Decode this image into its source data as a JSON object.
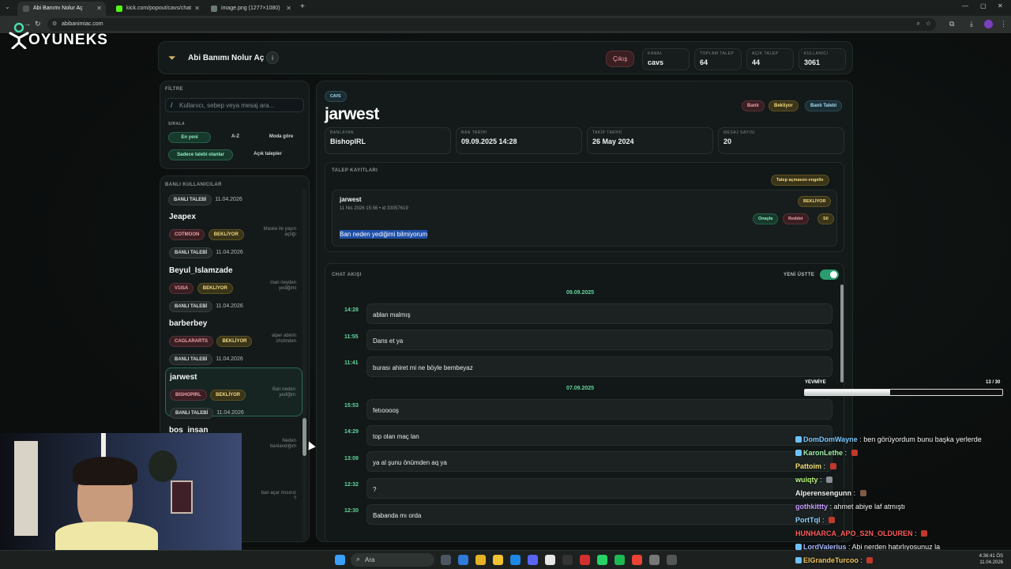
{
  "browser": {
    "tabs": [
      {
        "label": "Abi Banımı Nolur Aç"
      },
      {
        "label": "kick.com/popout/cavs/chat"
      },
      {
        "label": "image.png (1277×1080)"
      }
    ],
    "url": "abibanimiac.com"
  },
  "overlay": {
    "logo_text": "OYUNEKS"
  },
  "header": {
    "title": "Abi Banımı Nolur Aç",
    "info": "i",
    "logout": "Çıkış",
    "stats": [
      {
        "key": "KANAL",
        "value": "cavs"
      },
      {
        "key": "TOPLAM TALEP",
        "value": "64"
      },
      {
        "key": "AÇIK TALEP",
        "value": "44"
      },
      {
        "key": "KULLANICI",
        "value": "3061"
      }
    ]
  },
  "filter": {
    "label": "FİLTRE",
    "placeholder": "Kullanıcı, sebep veya mesaj ara...",
    "sort_label": "SIRALA",
    "sort": [
      "En yeni",
      "A-Z",
      "Moda göre"
    ],
    "only_requests": "Sadece talebi olanlar",
    "open_requests": "Açık talepler"
  },
  "banned": {
    "label": "BANLI KULLANICILAR",
    "first_row": {
      "tag": "BANLI TALEBİ",
      "date": "11.04.2026"
    },
    "users": [
      {
        "name": "Jeapex",
        "by": "COTMOON",
        "status": "BEKLİYOR",
        "tag": "BANLI TALEBİ",
        "date": "11.04.2026",
        "note": "Maske ile yayın açtığı"
      },
      {
        "name": "Beyul_Islamzade",
        "by": "V1ISA",
        "status": "BEKLİYOR",
        "tag": "BANLI TALEBİ",
        "date": "11.04.2026",
        "note": "inan neyden yediğimi"
      },
      {
        "name": "barberbey",
        "by": "CAGLARARTS",
        "status": "BEKLİYOR",
        "tag": "BANLI TALEBİ",
        "date": "11.04.2026",
        "note": "alper abinin chstinden"
      },
      {
        "name": "jarwest",
        "by": "BISHOPIRL",
        "status": "BEKLİYOR",
        "tag": "BANLI TALEBİ",
        "date": "11.04.2026",
        "note": "Ban neden yediğim"
      },
      {
        "name": "bos_insan",
        "note": "Neden banlandığım"
      }
    ],
    "last_note": "ban açar mısınız ?"
  },
  "detail": {
    "channel_tag": "CAVS",
    "username": "jarwest",
    "actions": [
      "Banlı",
      "Bekliyor",
      "Banlı Talebi"
    ],
    "meta": [
      {
        "key": "BANLAYAN",
        "value": "BishopIRL"
      },
      {
        "key": "BAN TARİHİ",
        "value": "09.09.2025 14:28"
      },
      {
        "key": "TAKİP TARİHİ",
        "value": "26 May 2024"
      },
      {
        "key": "MESAJ SAYISI",
        "value": "20"
      }
    ],
    "requests_label": "TALEP KAYITLARI",
    "block_button": "Talep açmasını engelle",
    "request": {
      "user": "jarwest",
      "meta": "11 Nis 2026 15:56 • id 33057619",
      "status": "BEKLİYOR",
      "approve": "Onayla",
      "reject": "Reddet",
      "delete": "Sil",
      "message": "Ban neden yediğimi bilmiyorum"
    },
    "chat_label": "CHAT AKIŞI",
    "newest_top": "YENİ ÜSTTE",
    "days": [
      "09.09.2025",
      "07.09.2025"
    ],
    "messages": [
      {
        "time": "14:28",
        "text": "ablan malmış"
      },
      {
        "time": "11:55",
        "text": "Dans et ya"
      },
      {
        "time": "11:41",
        "text": "burası ahiret mi ne böyle bembeyaz"
      },
      {
        "time": "15:53",
        "text": "fetıooooş"
      },
      {
        "time": "14:29",
        "text": "top olan maç lan"
      },
      {
        "time": "13:09",
        "text": "ya al şunu önümden aq ya"
      },
      {
        "time": "12:32",
        "text": "?"
      },
      {
        "time": "12:30",
        "text": "Babanda mı orda"
      }
    ]
  },
  "stream": {
    "progress_label": "YEVMİYE",
    "progress_text": "13 / 30",
    "progress_value": 0.43,
    "chat": [
      {
        "user": "DomDomWayne",
        "color": "#7cc8ff",
        "text": "ben görüyordum bunu başka yerlerde"
      },
      {
        "user": "KaronLethe",
        "color": "#9ef0a8",
        "text": ""
      },
      {
        "user": "Pattoim",
        "color": "#f5e27a",
        "text": ""
      },
      {
        "user": "wuiqty",
        "color": "#b7f57a",
        "text": ""
      },
      {
        "user": "Alperensengunn",
        "color": "#f3f3f3",
        "text": ""
      },
      {
        "user": "gothkittty",
        "color": "#c79cff",
        "text": "ahmet abiye laf atmıştı"
      },
      {
        "user": "PortTql",
        "color": "#8fd3ff",
        "text": ""
      },
      {
        "user": "HUNHARCA_APO_S2N_OLDUREN",
        "color": "#ff5a5a",
        "text": ""
      },
      {
        "user": "LordValerius",
        "color": "#a6b8ff",
        "text": "Abi nerden hatırlıyosunuz la"
      },
      {
        "user": "ElGrandeTurcoo",
        "color": "#f2c45a",
        "text": ""
      }
    ]
  },
  "taskbar": {
    "search": "Ara",
    "time": "4:36:41 ÖS",
    "date": "11.04.2026"
  }
}
